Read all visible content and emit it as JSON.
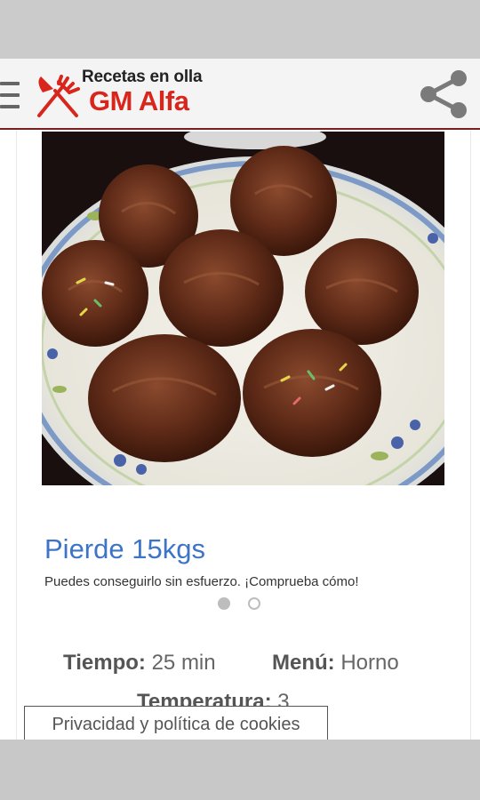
{
  "app": {
    "logo_line1": "Recetas en olla",
    "logo_line2": "GM Alfa",
    "brand_red": "#d9261c"
  },
  "toolbar": {
    "menu_icon": "hamburger-icon",
    "share_icon": "share-icon"
  },
  "recipe": {
    "image_subject": "chocolate cupcakes on a plate",
    "tiempo_label": "Tiempo:",
    "tiempo_value": "25 min",
    "menu_label": "Menú:",
    "menu_value": "Horno",
    "temperatura_label": "Temperatura:",
    "temperatura_value": "3"
  },
  "ad": {
    "title": "Pierde 15kgs",
    "description": "Puedes conseguirlo sin esfuerzo. ¡Comprueba cómo!",
    "pagination": {
      "count": 2,
      "active": 1
    }
  },
  "cookie_banner": {
    "label": "Privacidad y política de cookies"
  }
}
